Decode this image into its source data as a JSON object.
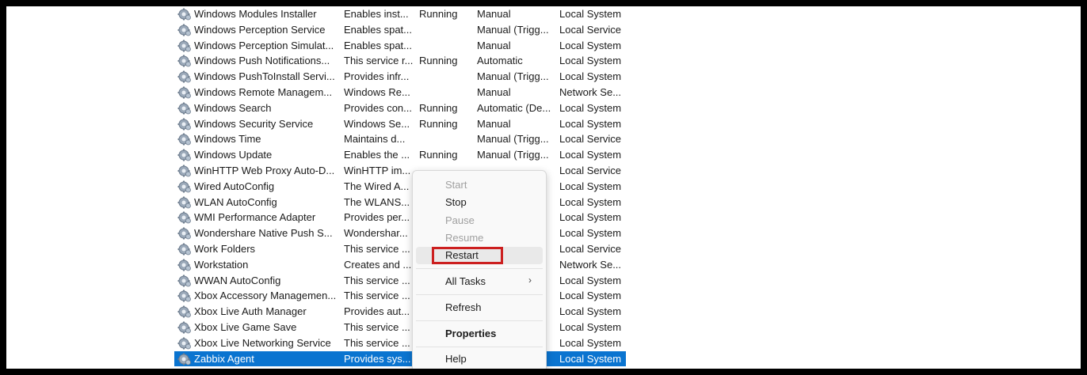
{
  "services": [
    {
      "name": "Windows Modules Installer",
      "description": "Enables inst...",
      "status": "Running",
      "startup": "Manual",
      "logon": "Local System"
    },
    {
      "name": "Windows Perception Service",
      "description": "Enables spat...",
      "status": "",
      "startup": "Manual (Trigg...",
      "logon": "Local Service"
    },
    {
      "name": "Windows Perception Simulat...",
      "description": "Enables spat...",
      "status": "",
      "startup": "Manual",
      "logon": "Local System"
    },
    {
      "name": "Windows Push Notifications...",
      "description": "This service r...",
      "status": "Running",
      "startup": "Automatic",
      "logon": "Local System"
    },
    {
      "name": "Windows PushToInstall Servi...",
      "description": "Provides infr...",
      "status": "",
      "startup": "Manual (Trigg...",
      "logon": "Local System"
    },
    {
      "name": "Windows Remote Managem...",
      "description": "Windows Re...",
      "status": "",
      "startup": "Manual",
      "logon": "Network Se..."
    },
    {
      "name": "Windows Search",
      "description": "Provides con...",
      "status": "Running",
      "startup": "Automatic (De...",
      "logon": "Local System"
    },
    {
      "name": "Windows Security Service",
      "description": "Windows Se...",
      "status": "Running",
      "startup": "Manual",
      "logon": "Local System"
    },
    {
      "name": "Windows Time",
      "description": "Maintains d...",
      "status": "",
      "startup": "Manual (Trigg...",
      "logon": "Local Service"
    },
    {
      "name": "Windows Update",
      "description": "Enables the ...",
      "status": "Running",
      "startup": "Manual (Trigg...",
      "logon": "Local System"
    },
    {
      "name": "WinHTTP Web Proxy Auto-D...",
      "description": "WinHTTP im...",
      "status": "",
      "startup": "",
      "logon": "Local Service"
    },
    {
      "name": "Wired AutoConfig",
      "description": "The Wired A...",
      "status": "",
      "startup": "",
      "logon": "Local System"
    },
    {
      "name": "WLAN AutoConfig",
      "description": "The WLANS...",
      "status": "",
      "startup": "",
      "logon": "Local System"
    },
    {
      "name": "WMI Performance Adapter",
      "description": "Provides per...",
      "status": "",
      "startup": "",
      "logon": "Local System"
    },
    {
      "name": "Wondershare Native Push S...",
      "description": "Wondershar...",
      "status": "",
      "startup": "",
      "logon": "Local System"
    },
    {
      "name": "Work Folders",
      "description": "This service ...",
      "status": "",
      "startup": "",
      "logon": "Local Service"
    },
    {
      "name": "Workstation",
      "description": "Creates and ...",
      "status": "",
      "startup": "",
      "logon": "Network Se..."
    },
    {
      "name": "WWAN AutoConfig",
      "description": "This service ...",
      "status": "",
      "startup": "",
      "logon": "Local System"
    },
    {
      "name": "Xbox Accessory Managemen...",
      "description": "This service ...",
      "status": "",
      "startup": "",
      "logon": "Local System"
    },
    {
      "name": "Xbox Live Auth Manager",
      "description": "Provides aut...",
      "status": "",
      "startup": "",
      "logon": "Local System"
    },
    {
      "name": "Xbox Live Game Save",
      "description": "This service ...",
      "status": "",
      "startup": "",
      "logon": "Local System"
    },
    {
      "name": "Xbox Live Networking Service",
      "description": "This service ...",
      "status": "",
      "startup": "",
      "logon": "Local System"
    },
    {
      "name": "Zabbix Agent",
      "description": "Provides sys...",
      "status": "",
      "startup": "",
      "logon": "Local System",
      "selected": true
    }
  ],
  "context_menu": {
    "start": "Start",
    "stop": "Stop",
    "pause": "Pause",
    "resume": "Resume",
    "restart": "Restart",
    "all_tasks": "All Tasks",
    "refresh": "Refresh",
    "properties": "Properties",
    "help": "Help",
    "submenu_chevron": "›"
  },
  "colors": {
    "selection": "#0a74d0",
    "highlight_box": "#cc1f1f",
    "frame": "#000000"
  },
  "icons": {
    "service": "gear-service-icon"
  }
}
